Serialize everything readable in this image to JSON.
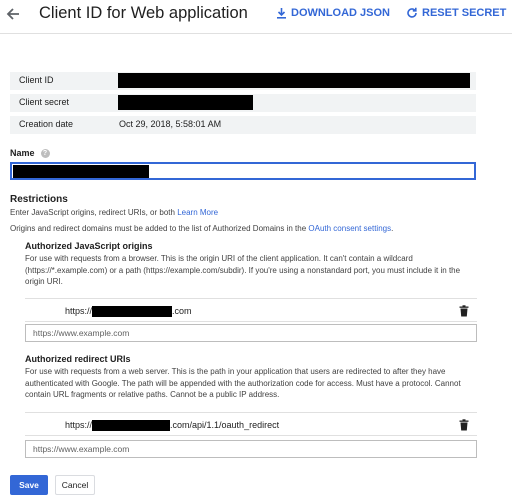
{
  "header": {
    "title": "Client ID for Web application",
    "download_label": "DOWNLOAD JSON",
    "reset_label": "RESET SECRET",
    "accent": "#3367d6"
  },
  "info": {
    "client_id_label": "Client ID",
    "client_secret_label": "Client secret",
    "creation_date_label": "Creation date",
    "creation_date_value": "Oct 29, 2018, 5:58:01 AM"
  },
  "name": {
    "label": "Name",
    "help_icon": "help-icon"
  },
  "restrictions": {
    "title": "Restrictions",
    "line1_text": "Enter JavaScript origins, redirect URIs, or both ",
    "line1_link": "Learn More",
    "line2_text": "Origins and redirect domains must be added to the list of Authorized Domains in the ",
    "line2_link": "OAuth consent settings",
    "line2_end": "."
  },
  "js_origins": {
    "title": "Authorized JavaScript origins",
    "desc": "For use with requests from a browser. This is the origin URI of the client application. It can't contain a wildcard (https://*.example.com) or a path (https://example.com/subdir). If you're using a nonstandard port, you must include it in the origin URI.",
    "uri_prefix": "https://",
    "uri_suffix": ".com",
    "input_placeholder": "https://www.example.com"
  },
  "redirect_uris": {
    "title": "Authorized redirect URIs",
    "desc": "For use with requests from a web server. This is the path in your application that users are redirected to after they have authenticated with Google. The path will be appended with the authorization code for access. Must have a protocol. Cannot contain URL fragments or relative paths. Cannot be a public IP address.",
    "uri_prefix": "https://",
    "uri_suffix": ".com/api/1.1/oauth_redirect",
    "input_placeholder": "https://www.example.com"
  },
  "actions": {
    "save_label": "Save",
    "cancel_label": "Cancel"
  }
}
